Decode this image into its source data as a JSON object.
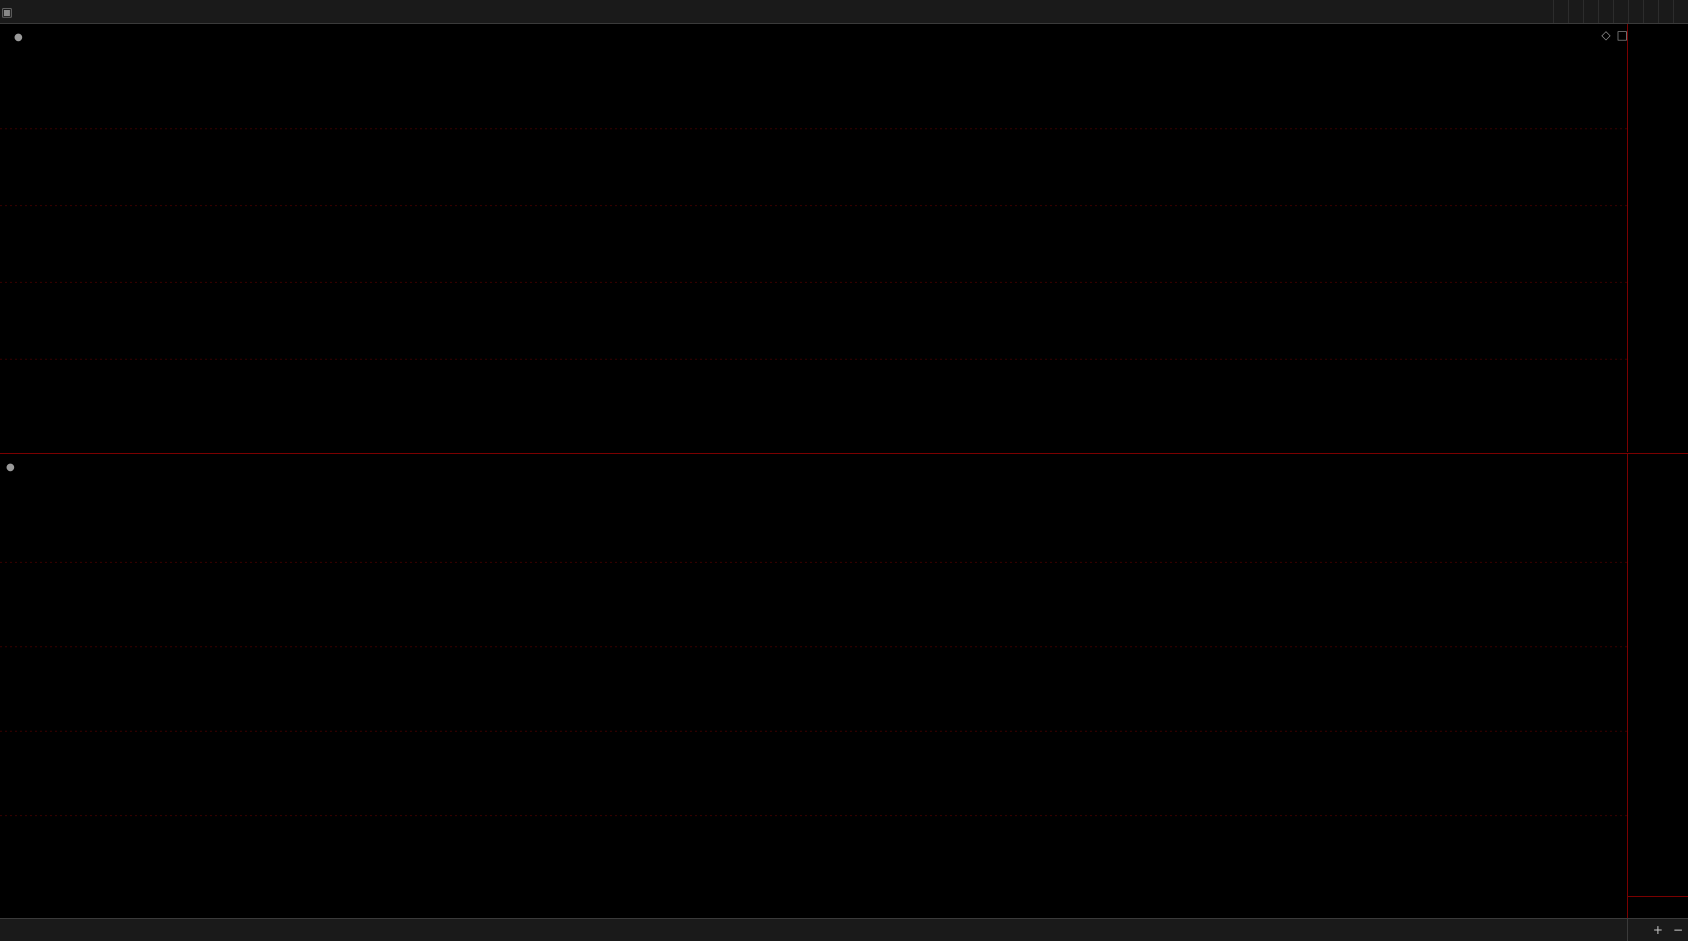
{
  "toolbar": {
    "period_tabs": [
      {
        "label": ""
      },
      {
        "label": ""
      },
      {
        "label": ""
      },
      {
        "label": ""
      },
      {
        "label": ""
      },
      {
        "label": ""
      },
      {
        "label": ""
      },
      {
        "label": ""
      },
      {
        "label": ""
      },
      {
        "label": ""
      },
      {
        "label": ""
      }
    ],
    "tools": [
      {
        "label": ""
      },
      {
        "label": ""
      },
      {
        "label": ""
      },
      {
        "label": ""
      },
      {
        "label": ""
      },
      {
        "label": ""
      },
      {
        "label": ""
      },
      {
        "label": ""
      },
      {
        "label": ""
      }
    ]
  },
  "main_chart": {
    "security_title": "",
    "template_label": "",
    "ma": [
      {
        "label": "",
        "value": "",
        "color": "#e6e6e6"
      },
      {
        "label": "",
        "value": "",
        "color": "#ff3b3b"
      },
      {
        "label": "",
        "value": "",
        "color": "#e8d84a"
      },
      {
        "label": "",
        "value": "",
        "color": "#2f5bff"
      }
    ],
    "colors": {
      "up": "#ff3b3b",
      "down": "#2ee6e6",
      "grid": "#3a0000"
    }
  },
  "sub_chart": {
    "indicator_name": "",
    "indicator_value_label": "",
    "indicator_value": ""
  },
  "bottom": {
    "indicator_tabs": [
      {
        "label": ""
      },
      {
        "label": ""
      },
      {
        "label": ""
      },
      {
        "label": ""
      },
      {
        "label": ""
      },
      {
        "label": ""
      },
      {
        "label": ""
      },
      {
        "label": ""
      },
      {
        "label": ""
      },
      {
        "label": ""
      },
      {
        "label": ""
      },
      {
        "label": ""
      },
      {
        "label": ""
      },
      {
        "label": ""
      },
      {
        "label": ""
      },
      {
        "label": ""
      },
      {
        "label": ""
      },
      {
        "label": ""
      },
      {
        "label": ""
      },
      {
        "label": ""
      }
    ],
    "right_tabs": [
      {
        "label": ""
      },
      {
        "label": ""
      }
    ],
    "period_label": ""
  },
  "chart_data": [
    {
      "type": "candlestick",
      "title": "",
      "x": [],
      "open": [],
      "high": [],
      "low": [],
      "close": [],
      "overlays": [
        {
          "name": "",
          "values": []
        },
        {
          "name": "",
          "values": []
        },
        {
          "name": "",
          "values": []
        },
        {
          "name": "",
          "values": []
        }
      ],
      "y_ticks": [],
      "x_tick_labels": [],
      "annotations": []
    },
    {
      "type": "bar",
      "title": "",
      "x": [],
      "values": [],
      "y_ticks": []
    }
  ]
}
